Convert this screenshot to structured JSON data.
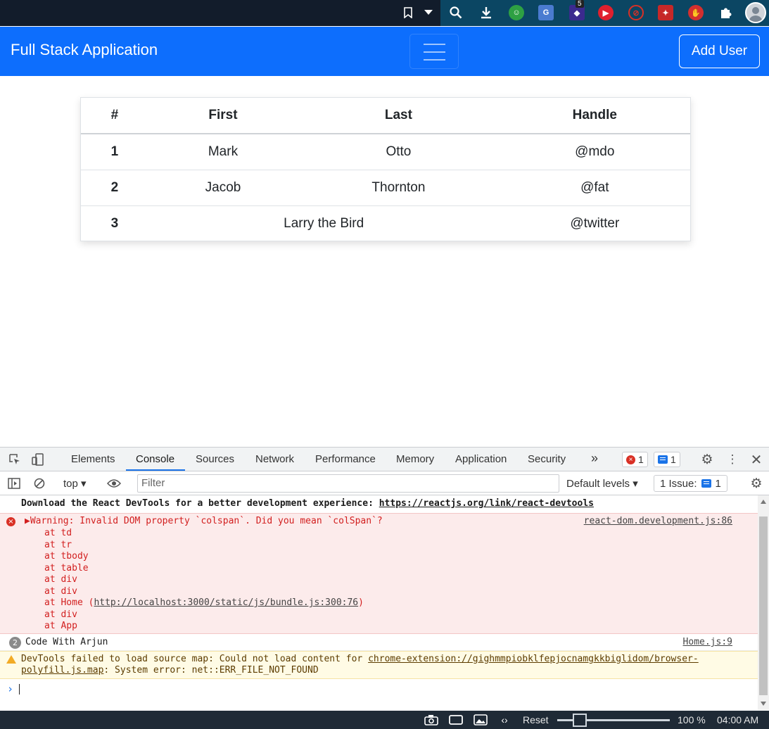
{
  "browser": {
    "extension_badge": "5",
    "extensions": [
      "search-icon",
      "download-icon",
      "green-extension-icon",
      "google-translate-icon",
      "stack-extension-icon",
      "youtube-extension-icon",
      "blocked-extension-icon",
      "magic-wand-icon",
      "stop-hand-icon",
      "puzzle-icon"
    ]
  },
  "navbar": {
    "brand": "Full Stack Application",
    "add_user_label": "Add User",
    "color": "#0d6efd"
  },
  "table": {
    "headers": [
      "#",
      "First",
      "Last",
      "Handle"
    ],
    "rows": [
      {
        "num": "1",
        "first": "Mark",
        "last": "Otto",
        "handle": "@mdo"
      },
      {
        "num": "2",
        "first": "Jacob",
        "last": "Thornton",
        "handle": "@fat"
      },
      {
        "num": "3",
        "first_last": "Larry the Bird",
        "handle": "@twitter"
      }
    ]
  },
  "devtools": {
    "tabs": [
      "Elements",
      "Console",
      "Sources",
      "Network",
      "Performance",
      "Memory",
      "Application",
      "Security"
    ],
    "active_tab": "Console",
    "more_tabs": "»",
    "error_count": "1",
    "message_count": "1",
    "context": "top",
    "filter_placeholder": "Filter",
    "default_levels": "Default levels",
    "issues_label": "1 Issue:",
    "issues_count": "1"
  },
  "console": {
    "info_text": "Download the React DevTools for a better development experience: ",
    "info_link": "https://reactjs.org/link/react-devtools",
    "error_header": "Warning: Invalid DOM property `colspan`. Did you mean `colSpan`?",
    "error_source": "react-dom.development.js:86",
    "stack": [
      "at td",
      "at tr",
      "at tbody",
      "at table",
      "at div",
      "at div"
    ],
    "stack_home_prefix": "at Home (",
    "stack_home_link": "http://localhost:3000/static/js/bundle.js:300:76",
    "stack_home_suffix": ")",
    "stack_tail": [
      "at div",
      "at App"
    ],
    "log_count": "2",
    "log_text": "Code With Arjun",
    "log_source": "Home.js:9",
    "warn_text": "DevTools failed to load source map: Could not load content for ",
    "warn_link": "chrome-extension://gighmmpiobklfepjocnamgkkbiglidom/browser-polyfill.js.map",
    "warn_suffix": ": System error: net::ERR_FILE_NOT_FOUND",
    "prompt": "›"
  },
  "statusbar": {
    "reset": "Reset",
    "zoom": "100 %",
    "time": "04:00 AM",
    "zoom_level": 0.2
  }
}
